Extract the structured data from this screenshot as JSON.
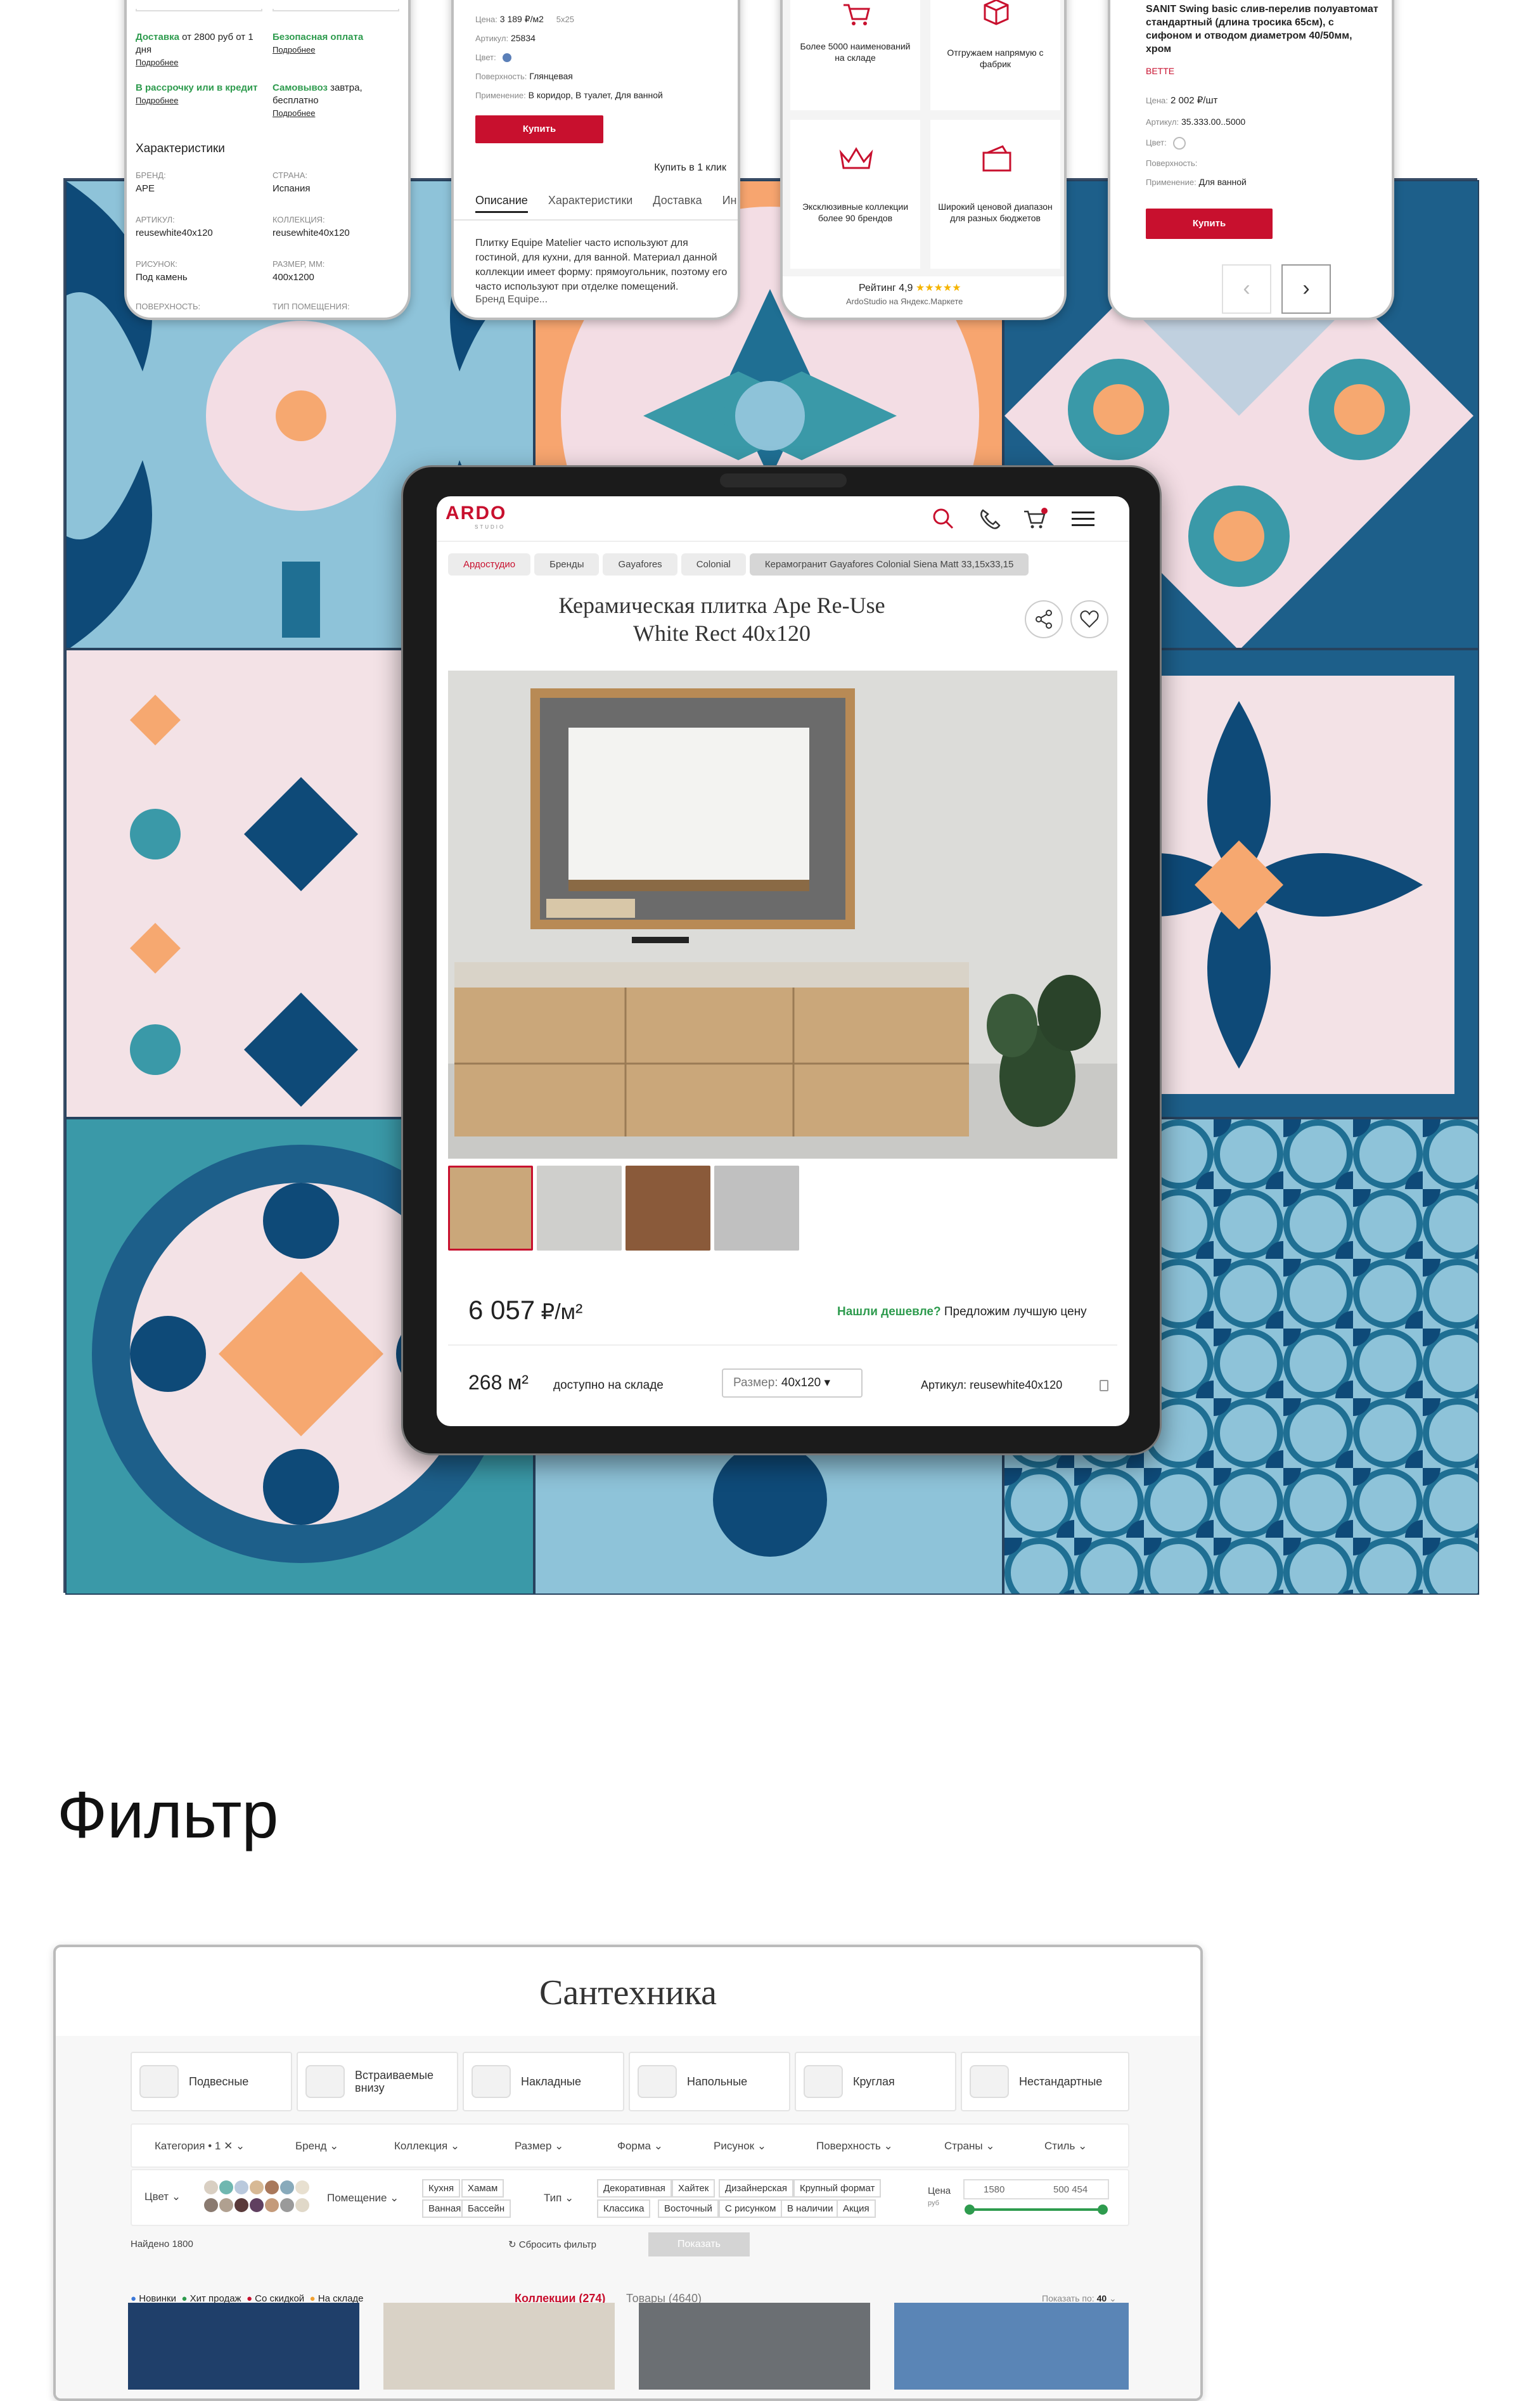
{
  "phone1": {
    "delivery": "Доставка",
    "delivery_rest": " от 2800 руб от 1 дня",
    "more1": "Подробнее",
    "safe_pay": "Безопасная оплата",
    "more2": "Подробнее",
    "credit": "В рассрочку или в кредит",
    "more3": "Подробнее",
    "pickup": "Самовывоз",
    "pickup_rest": " завтра, бесплатно",
    "more4": "Подробнее",
    "chars_title": "Характеристики",
    "brand_label": "БРЕНД:",
    "brand": "APE",
    "country_label": "СТРАНА:",
    "country": "Испания",
    "article_label": "АРТИКУЛ:",
    "article": "reusewhite40x120",
    "collection_label": "КОЛЛЕКЦИЯ:",
    "collection": "reusewhite40x120",
    "pattern_label": "РИСУНОК:",
    "pattern": "Под камень",
    "size_label": "РАЗМЕР, ММ:",
    "size": "400x1200",
    "surface_label": "ПОВЕРХНОСТЬ:",
    "room_label": "ТИП ПОМЕЩЕНИЯ:"
  },
  "phone2": {
    "price_label": "Цена:",
    "price": "3 189 ₽/м2",
    "price_size": "5x25",
    "article_label": "Артикул:",
    "article": "25834",
    "color_label": "Цвет:",
    "surface_label": "Поверхность:",
    "surface": "Глянцевая",
    "use_label": "Применение:",
    "use": "В коридор, В туалет, Для ванной",
    "buy": "Купить",
    "one_click": "Купить в 1 клик",
    "tabs": [
      "Описание",
      "Характеристики",
      "Доставка",
      "Ин"
    ],
    "desc": "Плитку Equipe Matelier часто используют для гостиной, для кухни, для ванной. Материал данной коллекции имеет форму: прямоугольник, поэтому его часто используют при отделке помещений.",
    "desc_tail": "Бренд Equipe..."
  },
  "phone3": {
    "f1": "Более 5000 наименований на складе",
    "f2": "Отгружаем напрямую с фабрик",
    "f3": "Эксклюзивные коллекции более 90 брендов",
    "f4": "Широкий ценовой диапазон для разных бюджетов",
    "rating": "Рейтинг 4,9",
    "stars": "★★★★★",
    "footer": "ArdoStudio на Яндекс.Маркете"
  },
  "phone4": {
    "title": "SANIT Swing basic слив-перелив полуавтомат стандартный (длина тросика 65см), с сифоном и отводом диаметром 40/50мм, хром",
    "brand": "BETTE",
    "price_label": "Цена:",
    "price": "2 002 ₽/шт",
    "article_label": "Артикул:",
    "article": "35.333.00..5000",
    "color_label": "Цвет:",
    "surface_label": "Поверхность:",
    "use_label": "Применение:",
    "use": "Для ванной",
    "buy": "Купить",
    "prev": "‹",
    "next": "›"
  },
  "tablet": {
    "logo": "ARDO",
    "logo_sub": "STUDIO",
    "breadcrumbs": [
      "Ардостудио",
      "Бренды",
      "Gayafores",
      "Colonial",
      "Керамогранит Gayafores Colonial Siena Matt 33,15x33,15"
    ],
    "title_line1": "Керамическая плитка Ape Re-Use",
    "title_line2": "White Rect 40x120",
    "price": "6 057",
    "price_unit": " ₽/м²",
    "cheaper_link": "Нашли дешевле?",
    "cheaper_rest": " Предложим лучшую цену",
    "stock_qty": "268 м²",
    "stock_text": "доступно на складе",
    "size_label": "Размер:",
    "size_value": "40x120",
    "article": "Артикул: reusewhite40x120"
  },
  "filter_section_title": "Фильтр",
  "filter": {
    "title": "Сантехника",
    "categories": [
      "Подвесные",
      "Встраиваемые внизу",
      "Накладные",
      "Напольные",
      "Круглая",
      "Нестандартные"
    ],
    "filters": [
      "Категория • 1",
      "Бренд",
      "Коллекция",
      "Размер",
      "Форма",
      "Рисунок",
      "Поверхность",
      "Страны",
      "Стиль"
    ],
    "color_label": "Цвет",
    "room_label": "Помещение",
    "rooms": [
      "Кухня",
      "Хамам",
      "Ванная",
      "Бассейн"
    ],
    "type_label": "Тип",
    "types": [
      "Декоративная",
      "Хайтек",
      "Дизайнерская",
      "Крупный формат",
      "Классика",
      "Восточный",
      "С рисунком",
      "В наличии",
      "Акция"
    ],
    "price_label": "Цена",
    "price_unit": "руб",
    "price_min": "1580",
    "price_max": "500 454",
    "found": "Найдено 1800",
    "reset": "Сбросить фильтр",
    "show": "Показать",
    "tags": [
      "Новинки",
      "Хит продаж",
      "Со скидкой",
      "На складе"
    ],
    "tag_colors": [
      "#3c78d8",
      "#2e9b4e",
      "#c8102e",
      "#f0a030"
    ],
    "tab_collections": "Коллекции (274)",
    "tab_goods": "Товары (4640)",
    "show_by": "Показать по:",
    "show_by_value": "40",
    "colors": [
      "#d9cfc2",
      "#6fb7b0",
      "#b9c9dd",
      "#d7b995",
      "#a9785b",
      "#88aabb",
      "#e8e0d0",
      "#8a7a70",
      "#b0a090",
      "#5a3a3a",
      "#604060",
      "#c49a7a",
      "#9a9a9a",
      "#e0d8c8"
    ]
  }
}
